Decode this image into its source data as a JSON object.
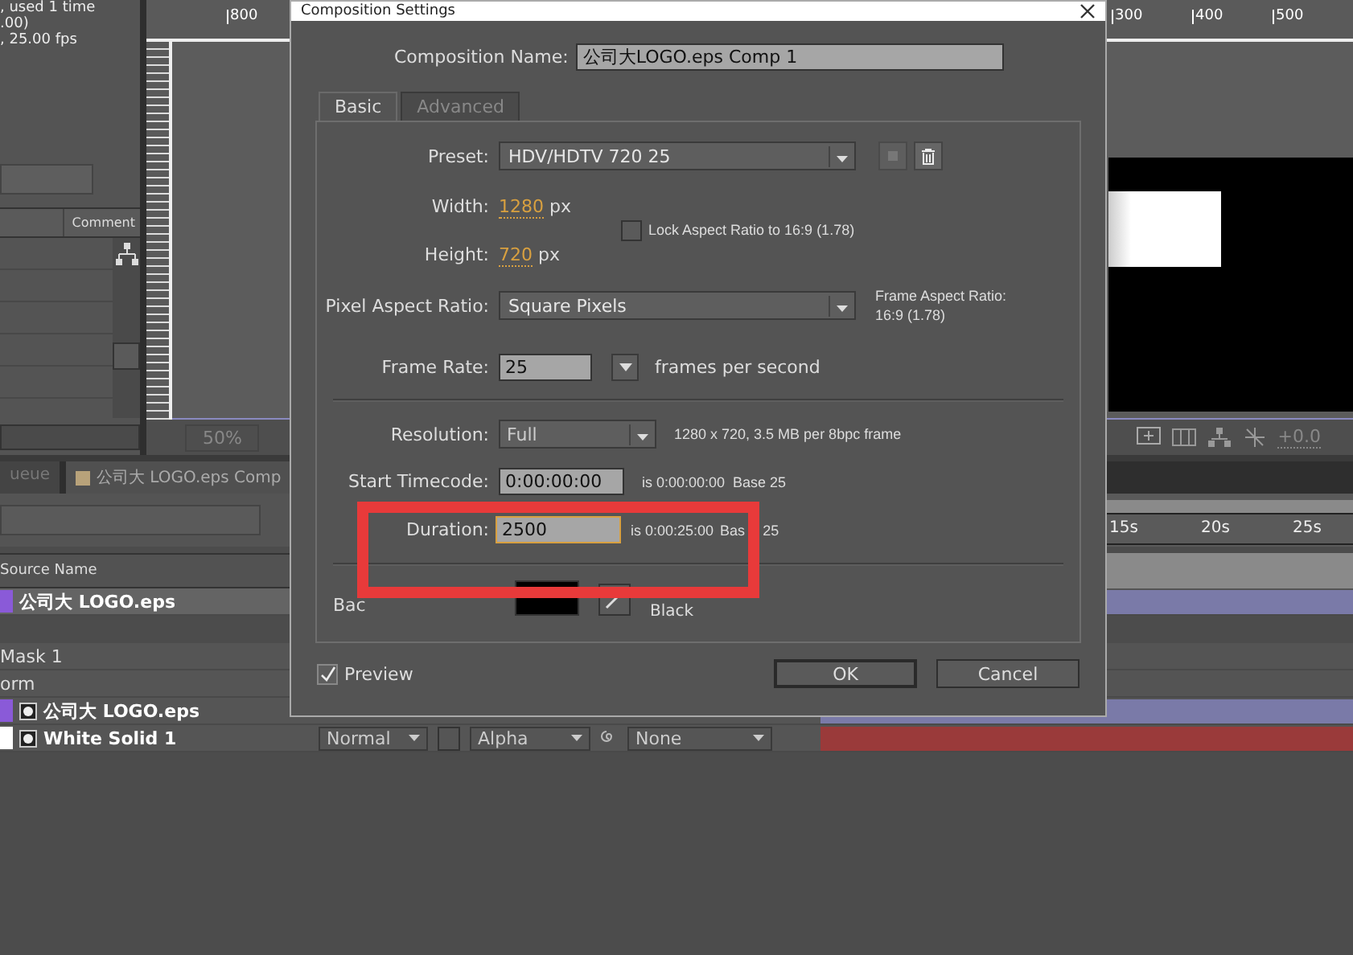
{
  "project_panel": {
    "info_lines": [
      ", used 1 time",
      ".00)",
      ", 25.00 fps"
    ],
    "columns": [
      "Comment"
    ]
  },
  "viewer": {
    "ruler_labels": [
      "800",
      "300",
      "400",
      "500"
    ],
    "zoom": "50%",
    "exposure": "+0.0"
  },
  "timeline": {
    "tabs": [
      {
        "label": "ueue",
        "selected": false
      },
      {
        "label": "公司大 LOGO.eps Comp",
        "selected": true
      }
    ],
    "columns": [
      "Source Name"
    ],
    "time_ticks": [
      "15s",
      "20s",
      "25s"
    ],
    "rows": [
      {
        "kind": "layer",
        "name": "公司大 LOGO.eps",
        "label": {
          "color": "#8a5ad8"
        },
        "bar": {
          "color": "#7a7aa8"
        },
        "selected": true
      },
      {
        "kind": "property",
        "name": "Mask 1"
      },
      {
        "kind": "property",
        "name": "orm"
      },
      {
        "kind": "layer",
        "name": "公司大 LOGO.eps",
        "label": {
          "color": "#8a5ad8"
        },
        "bar": {
          "color": "#7a7aa8"
        },
        "selected": false
      },
      {
        "kind": "layer",
        "name": "White Solid 1",
        "label": {
          "color": "#ffffff"
        },
        "bar": {
          "color": "#9a3a3a"
        },
        "selected": false,
        "mode": "Normal",
        "track_matte": "Alpha",
        "parent": "None"
      }
    ]
  },
  "dialog": {
    "title": "Composition Settings",
    "name_label": "Composition Name:",
    "name_value": "公司大LOGO.eps Comp 1",
    "tabs": [
      {
        "label": "Basic",
        "selected": true
      },
      {
        "label": "Advanced",
        "selected": false
      }
    ],
    "preset": {
      "label": "Preset:",
      "value": "HDV/HDTV 720 25"
    },
    "width": {
      "label": "Width:",
      "value": "1280",
      "unit": "px"
    },
    "height": {
      "label": "Height:",
      "value": "720",
      "unit": "px"
    },
    "lock_aspect": {
      "label": "Lock Aspect Ratio to 16:9 (1.78)",
      "checked": false
    },
    "pixel_aspect": {
      "label": "Pixel Aspect Ratio:",
      "value": "Square Pixels"
    },
    "frame_aspect": [
      "Frame Aspect Ratio:",
      "16:9 (1.78)"
    ],
    "frame_rate": {
      "label": "Frame Rate:",
      "value": "25",
      "unit": "frames per second"
    },
    "resolution": {
      "label": "Resolution:",
      "value": "Full",
      "info": "1280 x 720, 3.5 MB per 8bpc frame"
    },
    "start_timecode": {
      "label": "Start Timecode:",
      "value": "0:00:00:00",
      "info": "is 0:00:00:00  Base 25"
    },
    "duration": {
      "label": "Duration:",
      "value": "2500",
      "info": "is 0:00:25:00",
      "base": "Bas",
      "base_value": "25"
    },
    "background": {
      "label": "Bac",
      "color": "#000000",
      "color_name": "Black"
    },
    "preview": {
      "label": "Preview",
      "checked": true
    },
    "buttons": [
      {
        "label": "OK",
        "kind": "default"
      },
      {
        "label": "Cancel",
        "kind": "normal"
      }
    ]
  }
}
